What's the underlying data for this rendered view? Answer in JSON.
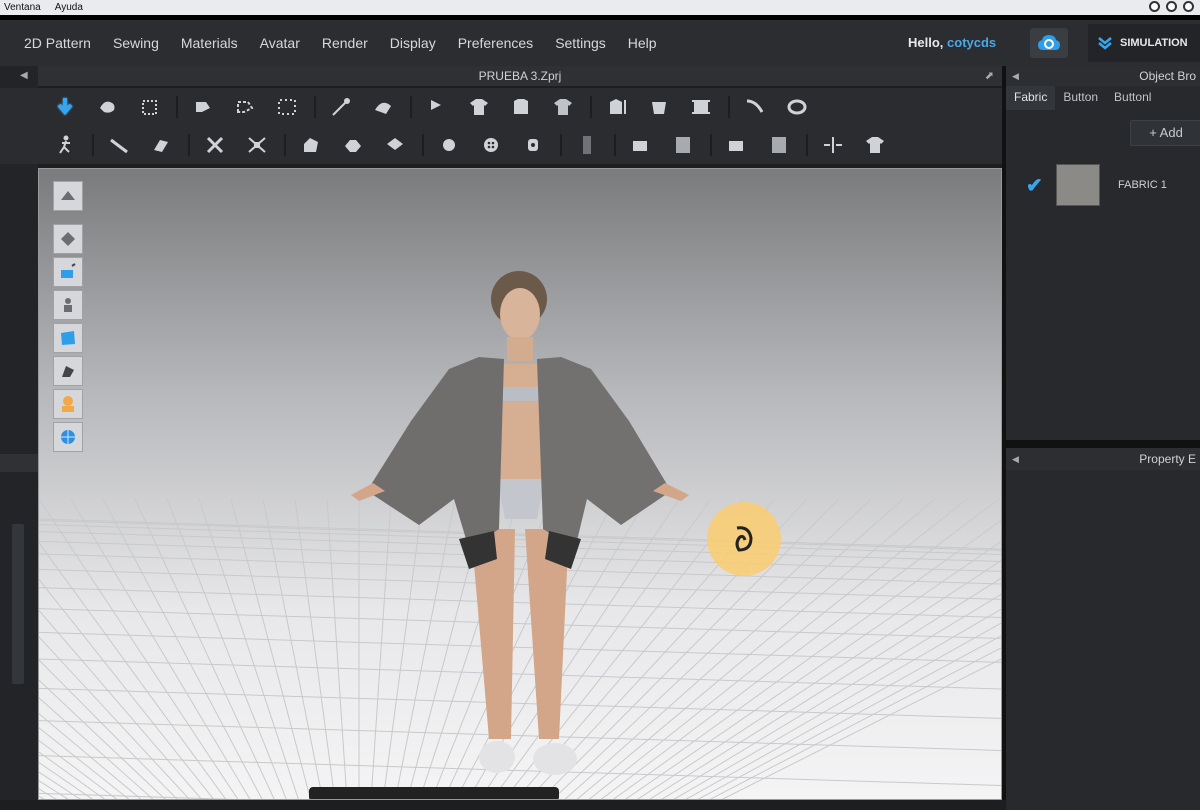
{
  "os_menu": [
    "Ventana",
    "Ayuda"
  ],
  "menu": [
    "2D Pattern",
    "Sewing",
    "Materials",
    "Avatar",
    "Render",
    "Display",
    "Preferences",
    "Settings",
    "Help"
  ],
  "greeting": "Hello,",
  "username": "cotycds",
  "simulation_label": "SIMULATION",
  "viewport_title": "PRUEBA 3.Zprj",
  "object_browser_title": "Object Bro",
  "object_tabs": [
    "Fabric",
    "Button",
    "Buttonl"
  ],
  "add_label": "+ Add",
  "fabric_item": "FABRIC 1",
  "property_editor_title": "Property E",
  "toolbar_row1_icons": [
    "select-arrow-icon",
    "hand-move-icon",
    "box-select-icon",
    "pattern-edit-icon",
    "pattern-points-icon",
    "pattern-grid-icon",
    "pin-icon",
    "fold-icon",
    "arrange-icon",
    "shirt-front-icon",
    "shirt-back-icon",
    "shirt-icon",
    "sew-icon",
    "sewing-machine-icon",
    "spool-icon",
    "tape-icon",
    "ring-icon"
  ],
  "toolbar_row2_icons": [
    "avatar-pose-icon",
    "measure-icon",
    "tack-icon",
    "cut-icon",
    "seam-icon",
    "puckering-icon",
    "fold-arrange-icon",
    "button-icon",
    "buttonhole-icon",
    "zipper-icon",
    "trim-icon",
    "topstitch-icon",
    "texture-icon",
    "texture-tile-icon",
    "symmetry-icon",
    "garment-fit-icon"
  ],
  "viewport_tools": [
    "display-mode-icon",
    "avatar-fit-icon",
    "color-fabric-icon",
    "avatar-show-icon",
    "texture-view-icon",
    "shade-mode-icon",
    "avatar-face-icon",
    "globe-icon"
  ],
  "colors": {
    "accent": "#37a6ee",
    "highlight": "#facd6e",
    "fabric": "#8b8a87"
  }
}
